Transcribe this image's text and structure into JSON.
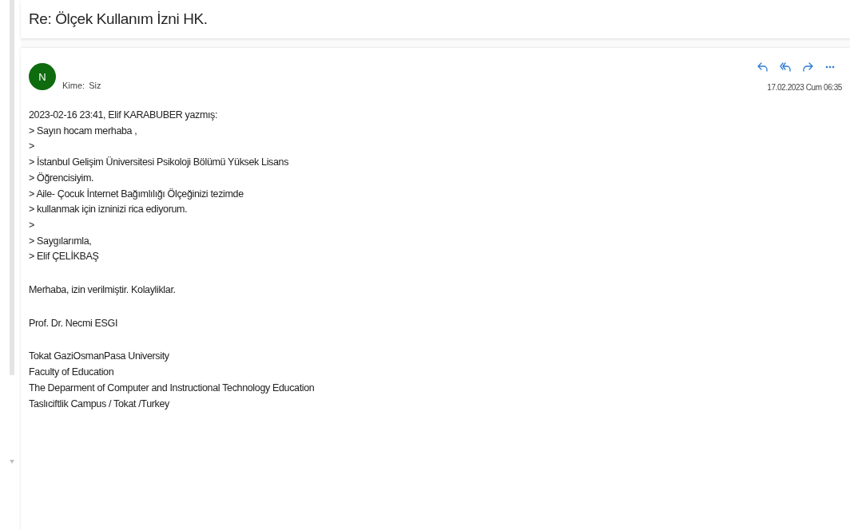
{
  "subject": "Re: Ölçek Kullanım İzni HK.",
  "message": {
    "avatar_initial": "N",
    "to_label": "Kime:",
    "to_value": "Siz",
    "date": "17.02.2023 Cum 06:35",
    "paragraphs": [
      [
        "2023-02-16 23:41, Elif KARABUBER yazmış:",
        "> Sayın hocam merhaba ,",
        ">",
        "> İstanbul Gelişim Üniversitesi Psikoloji Bölümü Yüksek Lisans",
        "> Öğrencisiyim.",
        "> Aile- Çocuk İnternet Bağımlılığı Ölçeğinizi tezimde",
        "> kullanmak için izninizi rica ediyorum.",
        ">",
        "> Saygılarımla,",
        "> Elif ÇELİKBAŞ"
      ],
      [
        "Merhaba, izin verilmiştir. Kolayliklar."
      ],
      [
        "Prof. Dr. Necmi ESGI"
      ],
      [
        "Tokat GaziOsmanPasa University",
        "Faculty of Education",
        "The Deparment of Computer and Instructional Technology Education",
        "Taslıciftlik Campus / Tokat /Turkey"
      ]
    ]
  }
}
